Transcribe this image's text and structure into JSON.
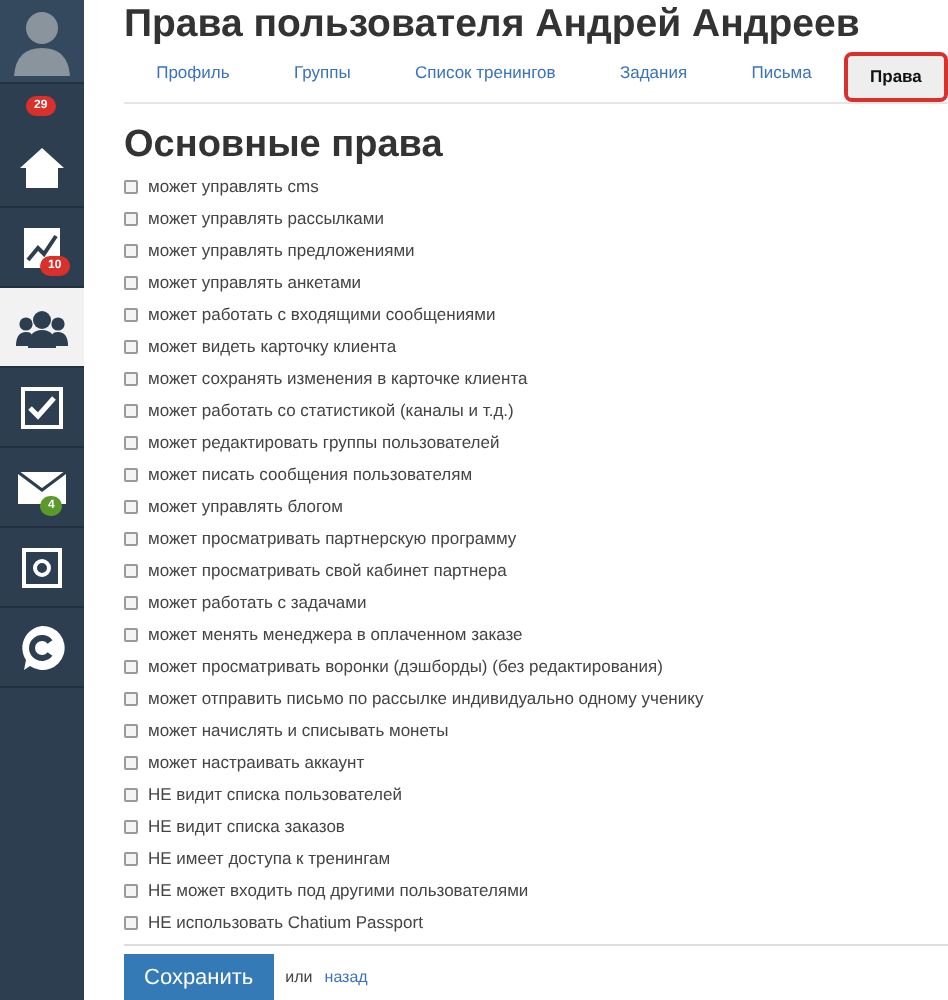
{
  "sidebar": {
    "items": [
      {
        "kind": "avatar",
        "selected": false
      },
      {
        "kind": "home",
        "selected": false,
        "badge": "29"
      },
      {
        "kind": "chart",
        "selected": false,
        "badge": "10"
      },
      {
        "kind": "users",
        "selected": true
      },
      {
        "kind": "check",
        "selected": false
      },
      {
        "kind": "mail",
        "selected": false,
        "badge": "4"
      },
      {
        "kind": "safe",
        "selected": false
      },
      {
        "kind": "chat",
        "selected": false
      }
    ]
  },
  "title": "Права пользователя Андрей Андреев",
  "tabs": [
    {
      "label": "Профиль",
      "selected": false
    },
    {
      "label": "Группы",
      "selected": false
    },
    {
      "label": "Список тренингов",
      "selected": false
    },
    {
      "label": "Задания",
      "selected": false
    },
    {
      "label": "Письма",
      "selected": false
    },
    {
      "label": "Права",
      "selected": true
    }
  ],
  "heading": "Основные права",
  "permissions": [
    {
      "label": "может управлять cms",
      "checked": false
    },
    {
      "label": "может управлять рассылками",
      "checked": false
    },
    {
      "label": "может управлять предложениями",
      "checked": false
    },
    {
      "label": "может управлять анкетами",
      "checked": false
    },
    {
      "label": "может работать с входящими сообщениями",
      "checked": false
    },
    {
      "label": "может видеть карточку клиента",
      "checked": false
    },
    {
      "label": "может сохранять изменения в карточке клиента",
      "checked": false
    },
    {
      "label": "может работать со статистикой (каналы и т.д.)",
      "checked": false
    },
    {
      "label": "может редактировать группы пользователей",
      "checked": false
    },
    {
      "label": "может писать сообщения пользователям",
      "checked": false
    },
    {
      "label": "может управлять блогом",
      "checked": false
    },
    {
      "label": "может просматривать партнерскую программу",
      "checked": false
    },
    {
      "label": "может просматривать свой кабинет партнера",
      "checked": false
    },
    {
      "label": "может работать с задачами",
      "checked": false
    },
    {
      "label": "может менять менеджера в оплаченном заказе",
      "checked": false
    },
    {
      "label": "может просматривать воронки (дэшборды) (без редактирования)",
      "checked": false
    },
    {
      "label": "может отправить письмо по рассылке индивидуально одному ученику",
      "checked": false
    },
    {
      "label": "может начислять и списывать монеты",
      "checked": false
    },
    {
      "label": "может настраивать аккаунт",
      "checked": false
    },
    {
      "label": "НЕ видит списка пользователей",
      "checked": false
    },
    {
      "label": "НЕ видит списка заказов",
      "checked": false
    },
    {
      "label": "НЕ имеет доступа к тренингам",
      "checked": false
    },
    {
      "label": "НЕ может входить под другими пользователями",
      "checked": false
    },
    {
      "label": "НЕ использовать Chatium Passport",
      "checked": false
    }
  ],
  "footer": {
    "button": "Сохранить",
    "or": "или",
    "back_link": "назад"
  }
}
